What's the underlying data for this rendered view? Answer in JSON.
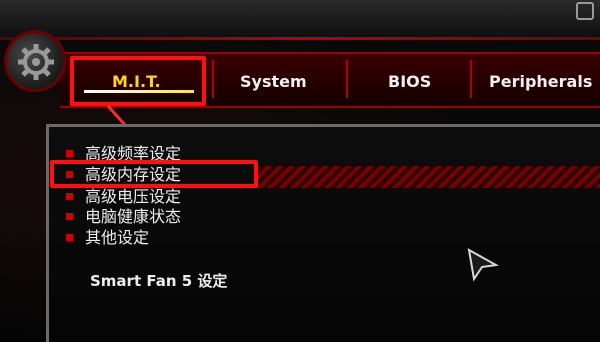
{
  "tabs": [
    {
      "label": "M.I.T."
    },
    {
      "label": "System"
    },
    {
      "label": "BIOS"
    },
    {
      "label": "Peripherals"
    }
  ],
  "menu": [
    {
      "label": "高级频率设定"
    },
    {
      "label": "高级内存设定"
    },
    {
      "label": "高级电压设定"
    },
    {
      "label": "电脑健康状态"
    },
    {
      "label": "其他设定"
    }
  ],
  "smart_fan_label": "Smart Fan 5 设定",
  "colors": {
    "accent_red": "#c10000",
    "highlight_box": "#ff1010",
    "active_tab_text": "#ffd21f",
    "text": "#ededed"
  },
  "icons": [
    "gear-icon",
    "window-icon",
    "arrow-icon",
    "mouse-cursor-icon"
  ]
}
